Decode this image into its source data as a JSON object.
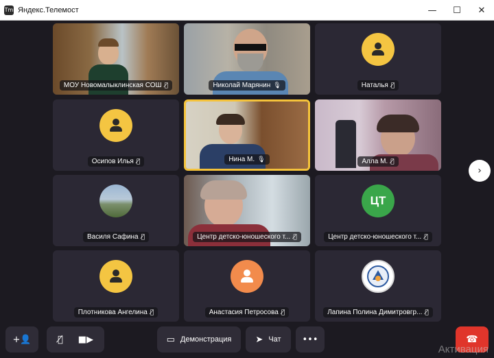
{
  "window": {
    "title": "Яндекс.Телемост",
    "icon_text": "Tm",
    "controls": {
      "minimize": "—",
      "maximize": "☐",
      "close": "✕"
    }
  },
  "participants": [
    {
      "name": "МОУ Новомалыклинская СОШ",
      "mic": "muted"
    },
    {
      "name": "Николай Марянин",
      "mic": "on"
    },
    {
      "name": "Наталья",
      "mic": "muted"
    },
    {
      "name": "Осипов Илья",
      "mic": "muted"
    },
    {
      "name": "Нина М.",
      "mic": "on"
    },
    {
      "name": "Алла М.",
      "mic": "muted"
    },
    {
      "name": "Василя Сафина",
      "mic": "muted"
    },
    {
      "name": "Центр детско-юношеского т...",
      "mic": "muted"
    },
    {
      "name": "Центр детско-юношеского т...",
      "mic": "muted",
      "initials": "ЦТ"
    },
    {
      "name": "Плотникова Ангелина",
      "mic": "muted"
    },
    {
      "name": "Анастасия Петросова",
      "mic": "muted"
    },
    {
      "name": "Лапина Полина Димитровгр...",
      "mic": "muted"
    }
  ],
  "icons": {
    "mic_muted": "🎙̸",
    "mic_on": "🎙",
    "next": "›",
    "add_person": "+👤",
    "mic_toggle": "🎙̸",
    "camera": "■▶",
    "screen": "▭",
    "chat": "➤",
    "more": "•••",
    "end_call": "☎"
  },
  "toolbar": {
    "screen_share_label": "Демонстрация",
    "chat_label": "Чат"
  },
  "watermark": "Активация",
  "colors": {
    "background": "#1c1a21",
    "tile": "#2b2834",
    "active_border": "#f5c33b",
    "avatar_yellow": "#f4c542",
    "avatar_orange": "#f28b4c",
    "avatar_green": "#3aa64a",
    "end_call": "#e0352b"
  }
}
